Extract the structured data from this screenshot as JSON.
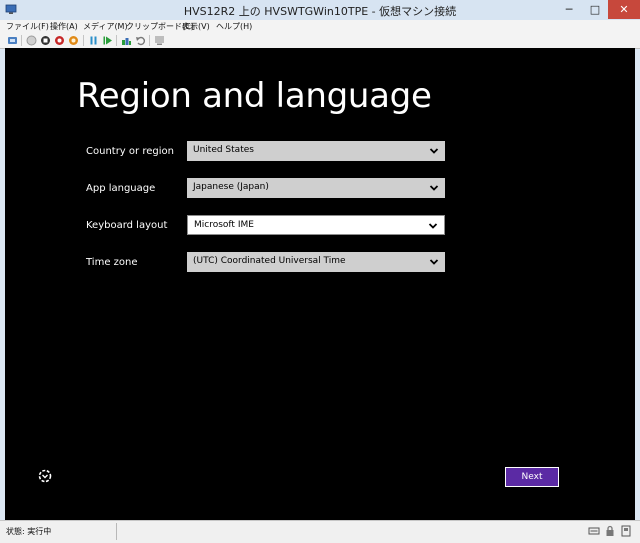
{
  "window": {
    "title": "HVS12R2 上の HVSWTGWin10TPE  - 仮想マシン接続",
    "controls": {
      "minimize": "─",
      "maximize": "□",
      "close": "✕"
    }
  },
  "menubar": {
    "items": [
      {
        "label": "ファイル(F)"
      },
      {
        "label": "操作(A)"
      },
      {
        "label": "メディア(M)"
      },
      {
        "label": "クリップボード(C)"
      },
      {
        "label": "表示(V)"
      },
      {
        "label": "ヘルプ(H)"
      }
    ]
  },
  "toolbar": {
    "icons": [
      "ctrl-alt-del-icon",
      "start-icon",
      "turn-off-icon",
      "shut-down-icon",
      "save-icon",
      "pause-icon",
      "resume-icon",
      "checkpoint-icon",
      "revert-icon",
      "enhanced-session-icon"
    ]
  },
  "setup": {
    "heading": "Region and language",
    "fields": [
      {
        "label": "Country or region",
        "value": "United States"
      },
      {
        "label": "App language",
        "value": "Japanese (Japan)"
      },
      {
        "label": "Keyboard layout",
        "value": "Microsoft IME"
      },
      {
        "label": "Time zone",
        "value": "(UTC) Coordinated Universal Time"
      }
    ],
    "next_label": "Next"
  },
  "statusbar": {
    "status": "状態: 実行中"
  },
  "colors": {
    "accent_button": "#5b2aa4",
    "screen_bg": "#000000",
    "window_frame": "#dde8f4"
  }
}
